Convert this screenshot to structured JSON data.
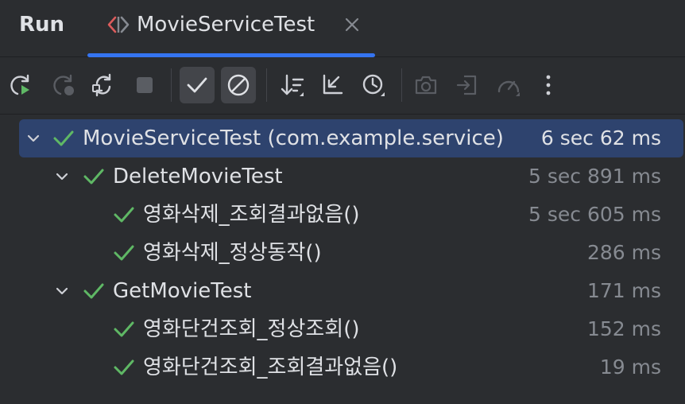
{
  "panel": {
    "title": "Run"
  },
  "tab": {
    "label": "MovieServiceTest",
    "icon": "test-run-icon",
    "close_icon": "close-icon"
  },
  "toolbar": {
    "buttons": [
      {
        "name": "rerun-button",
        "icon": "rerun-icon",
        "enabled": true,
        "active": false
      },
      {
        "name": "rerun-failed-button",
        "icon": "rerun-failed-icon",
        "enabled": false,
        "active": false
      },
      {
        "name": "toggle-auto-test-button",
        "icon": "auto-test-icon",
        "enabled": true,
        "active": false
      },
      {
        "name": "stop-button",
        "icon": "stop-icon",
        "enabled": false,
        "active": false
      },
      {
        "name": "show-passed-button",
        "icon": "check-icon",
        "enabled": true,
        "active": true
      },
      {
        "name": "show-ignored-button",
        "icon": "ignored-icon",
        "enabled": true,
        "active": true
      },
      {
        "name": "sort-alphabetically-button",
        "icon": "sort-icon",
        "enabled": true,
        "active": false
      },
      {
        "name": "collapse-all-button",
        "icon": "collapse-icon",
        "enabled": true,
        "active": false
      },
      {
        "name": "sort-by-duration-button",
        "icon": "clock-icon",
        "enabled": true,
        "active": false
      },
      {
        "name": "export-screenshot-button",
        "icon": "camera-icon",
        "enabled": false,
        "active": false
      },
      {
        "name": "import-tests-button",
        "icon": "import-icon",
        "enabled": false,
        "active": false
      },
      {
        "name": "profiler-button",
        "icon": "gauge-icon",
        "enabled": false,
        "active": false
      },
      {
        "name": "more-options-button",
        "icon": "more-vertical-icon",
        "enabled": true,
        "active": false
      }
    ]
  },
  "tree": {
    "root": {
      "label": "MovieServiceTest (com.example.service)",
      "time": "6 sec 62 ms",
      "status": "passed",
      "selected": true
    },
    "classes": [
      {
        "label": "DeleteMovieTest",
        "time": "5 sec 891 ms",
        "status": "passed",
        "methods": [
          {
            "label": "영화삭제_조회결과없음()",
            "time": "5 sec 605 ms",
            "status": "passed"
          },
          {
            "label": "영화삭제_정상동작()",
            "time": "286 ms",
            "status": "passed"
          }
        ]
      },
      {
        "label": "GetMovieTest",
        "time": "171 ms",
        "status": "passed",
        "methods": [
          {
            "label": "영화단건조회_정상조회()",
            "time": "152 ms",
            "status": "passed"
          },
          {
            "label": "영화단건조회_조회결과없음()",
            "time": "19 ms",
            "status": "passed"
          }
        ]
      }
    ]
  },
  "colors": {
    "background": "#2b2d30",
    "accent": "#3574f0",
    "selection": "#2e436e",
    "passed": "#5fb865",
    "text": "#dfe1e5",
    "muted_text": "#868a91",
    "disabled_icon": "#6f737a"
  }
}
